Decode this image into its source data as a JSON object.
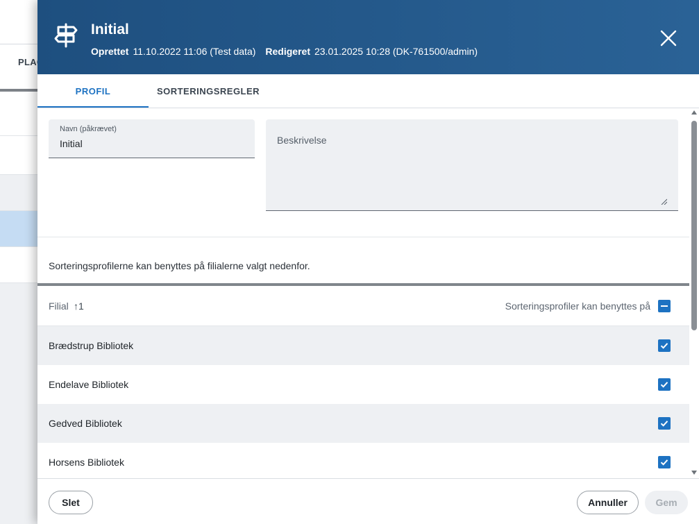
{
  "background": {
    "tab_label": "PLAC"
  },
  "header": {
    "title": "Initial",
    "created_label": "Oprettet",
    "created_value": "11.10.2022 11:06 (Test data)",
    "edited_label": "Redigeret",
    "edited_value": "23.01.2025 10:28 (DK-761500/admin)",
    "icon": "signpost-icon",
    "close_icon": "close-icon"
  },
  "tabs": [
    {
      "label": "PROFIL",
      "active": true
    },
    {
      "label": "SORTERINGSREGLER",
      "active": false
    }
  ],
  "form": {
    "name_label": "Navn (påkrævet)",
    "name_value": "Initial",
    "description_placeholder": "Beskrivelse"
  },
  "info_text": "Sorteringsprofilerne kan benyttes på filialerne valgt nedenfor.",
  "table": {
    "col_filial": "Filial",
    "sort_indicator": "↑1",
    "col_usage": "Sorteringsprofiler kan benyttes på",
    "rows": [
      {
        "name": "Brædstrup Bibliotek",
        "checked": true
      },
      {
        "name": "Endelave Bibliotek",
        "checked": true
      },
      {
        "name": "Gedved Bibliotek",
        "checked": true
      },
      {
        "name": "Horsens Bibliotek",
        "checked": true
      }
    ]
  },
  "footer": {
    "delete_label": "Slet",
    "cancel_label": "Annuller",
    "save_label": "Gem"
  },
  "colors": {
    "header": "#1e4f7f",
    "accent": "#1d72c2"
  }
}
